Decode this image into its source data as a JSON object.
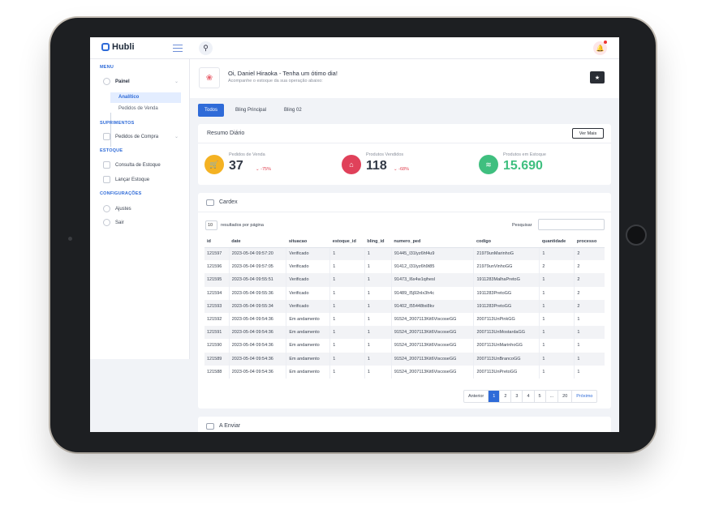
{
  "brand": {
    "name": "Hubli"
  },
  "sidebar": {
    "sections": {
      "menu": "MENU",
      "suprimentos": "SUPRIMENTOS",
      "estoque": "ESTOQUE",
      "configuracoes": "CONFIGURAÇÕES"
    },
    "painel": "Painel",
    "painel_sub": [
      "Analítico",
      "Pedidos de Venda"
    ],
    "pedidos_compra": "Pedidos de Compra",
    "consulta_estoque": "Consulta de Estoque",
    "lancar_estoque": "Lançar Estoque",
    "ajustes": "Ajustes",
    "sair": "Sair"
  },
  "welcome": {
    "title": "Oi, Daniel Hiraoka - Tenha um ótimo dia!",
    "subtitle": "Acompanhe o estoque da sua operação abaixo:"
  },
  "tabs": [
    "Todos",
    "Bling Principal",
    "Bling 02"
  ],
  "resumo": {
    "title": "Resumo Diário",
    "ver_mais": "Ver Mais",
    "stats": [
      {
        "label": "Pedidos de Venda",
        "value": "37",
        "change": "-75%",
        "color": "#f4b223"
      },
      {
        "label": "Produtos Vendidos",
        "value": "118",
        "change": "-68%",
        "color": "#e0415a"
      },
      {
        "label": "Produtos em Estoque",
        "value": "15.690",
        "change": "",
        "color": "#3fbf7f"
      }
    ]
  },
  "cardex": {
    "title": "Cardex",
    "page_length": "10",
    "length_label": "resultados por página",
    "search_label": "Pesquisar",
    "search_value": "",
    "columns": [
      "id",
      "date",
      "situacao",
      "estoque_id",
      "bling_id",
      "numero_ped",
      "codigo",
      "quantidade",
      "processo"
    ],
    "rows": [
      [
        "121597",
        "2023-05-04 09:57:20",
        "Verificado",
        "1",
        "1",
        "91445_I31lyz6hf4u9",
        "21979unMarinhoG",
        "1",
        "2"
      ],
      [
        "121596",
        "2023-05-04 09:57:05",
        "Verificado",
        "1",
        "1",
        "91412_I31lyz6h9t85",
        "21979unVinhoGG",
        "2",
        "2"
      ],
      [
        "121595",
        "2023-05-04 09:55:51",
        "Verificado",
        "1",
        "1",
        "91473_I6x4w1qihesl",
        "1911283MalhaPretoG",
        "1",
        "2"
      ],
      [
        "121594",
        "2023-05-04 09:55:36",
        "Verificado",
        "1",
        "1",
        "91489_I5j92nlx3h4c",
        "1911283PretoGG",
        "1",
        "2"
      ],
      [
        "121593",
        "2023-05-04 09:55:34",
        "Verificado",
        "1",
        "1",
        "91402_I55448txi8kv",
        "1911283PretoGG",
        "1",
        "2"
      ],
      [
        "121592",
        "2023-05-04 09:54:36",
        "Em andamento",
        "1",
        "1",
        "91524_2007113Kit6ViscoseGG",
        "2007113UnPinkGG",
        "1",
        "1"
      ],
      [
        "121591",
        "2023-05-04 09:54:36",
        "Em andamento",
        "1",
        "1",
        "91524_2007113Kit6ViscoseGG",
        "2007113UnMostardaGG",
        "1",
        "1"
      ],
      [
        "121590",
        "2023-05-04 09:54:36",
        "Em andamento",
        "1",
        "1",
        "91524_2007113Kit6ViscoseGG",
        "2007113UnMarinhoGG",
        "1",
        "1"
      ],
      [
        "121589",
        "2023-05-04 09:54:36",
        "Em andamento",
        "1",
        "1",
        "91524_2007113Kit6ViscoseGG",
        "2007113UnBrancoGG",
        "1",
        "1"
      ],
      [
        "121588",
        "2023-05-04 09:54:36",
        "Em andamento",
        "1",
        "1",
        "91524_2007113Kit6ViscoseGG",
        "2007113UnPretoGG",
        "1",
        "1"
      ]
    ],
    "pagination": [
      "Anterior",
      "1",
      "2",
      "3",
      "4",
      "5",
      "...",
      "20",
      "Próximo"
    ],
    "current_page": "1"
  },
  "a_enviar": {
    "title": "A Enviar"
  },
  "icons": {
    "search": "search-icon",
    "bell": "bell-icon",
    "star": "star-icon",
    "cart": "cart-icon",
    "tag": "tag-icon",
    "layers": "layers-icon"
  }
}
